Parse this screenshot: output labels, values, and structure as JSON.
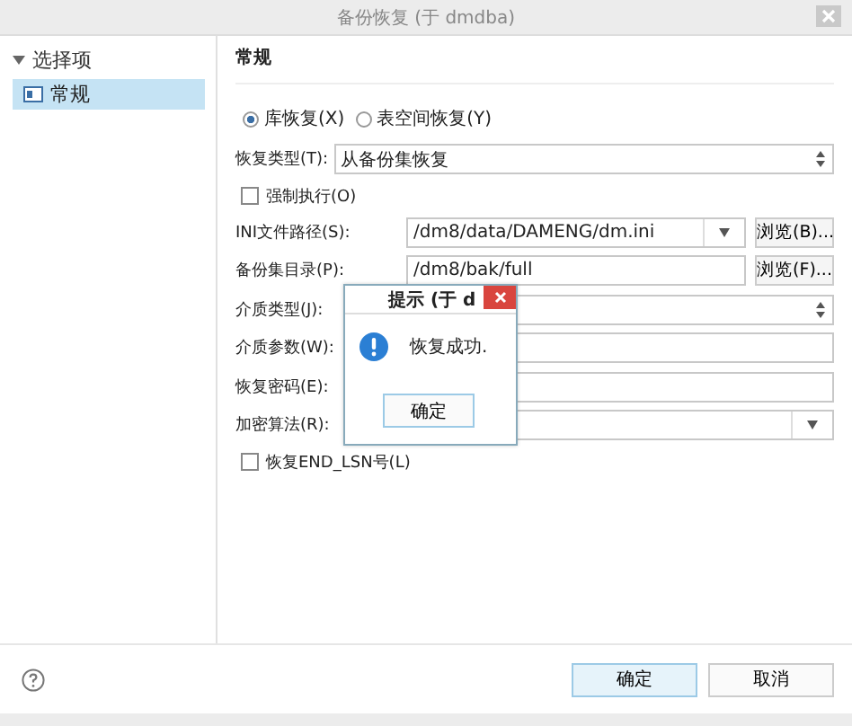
{
  "window": {
    "title": "备份恢复 (于 dmdba)"
  },
  "sidebar": {
    "label": "选择项",
    "expanded": true,
    "children": [
      {
        "label": "常规",
        "selected": true
      }
    ]
  },
  "panel": {
    "heading": "常规",
    "radios": [
      {
        "label": "库恢复(X)",
        "selected": true
      },
      {
        "label": "表空间恢复(Y)",
        "selected": false
      }
    ],
    "rows": [
      {
        "kind": "spinner",
        "label": "恢复类型(T):",
        "value": "从备份集恢复",
        "wide": true
      },
      {
        "kind": "checkbox",
        "label": "强制执行(O)",
        "checked": false
      },
      {
        "kind": "combo",
        "label": "INI文件路径(S):",
        "value": "/dm8/data/DAMENG/dm.ini",
        "button": "浏览(B)..."
      },
      {
        "kind": "text",
        "label": "备份集目录(P):",
        "value": "/dm8/bak/full",
        "button": "浏览(F)..."
      },
      {
        "kind": "spinner",
        "label": "介质类型(J):"
      },
      {
        "kind": "text",
        "label": "介质参数(W):"
      },
      {
        "kind": "text",
        "label": "恢复密码(E):"
      },
      {
        "kind": "combo",
        "label": "加密算法(R):"
      },
      {
        "kind": "checkbox",
        "label": "恢复END_LSN号(L)",
        "checked": false
      }
    ]
  },
  "footer": {
    "buttons": [
      {
        "label": "确定",
        "default": true
      },
      {
        "label": "取消",
        "default": false
      }
    ]
  },
  "dialog": {
    "title": "提示 (于 d",
    "message": "恢复成功.",
    "button": "确定"
  }
}
